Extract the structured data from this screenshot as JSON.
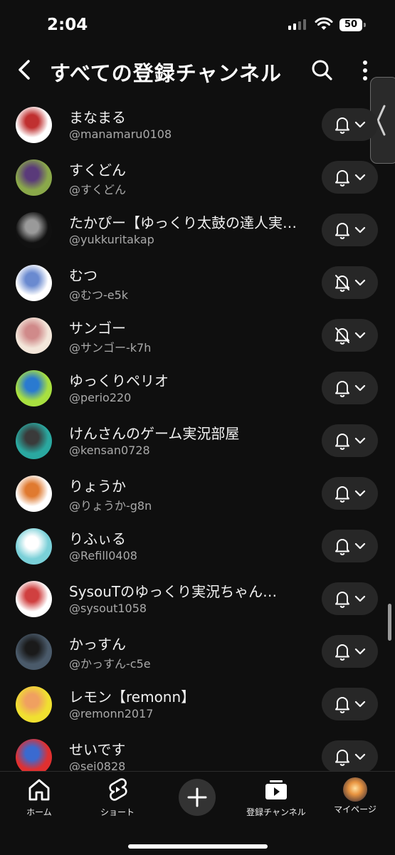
{
  "status_bar": {
    "time": "2:04",
    "battery": "50"
  },
  "header": {
    "title": "すべての登録チャンネル"
  },
  "channels": [
    {
      "name": "まなまる",
      "handle": "@manamaru0108",
      "notifications": "on",
      "avatar_colors": [
        "#ffffff",
        "#c03030"
      ]
    },
    {
      "name": "すくどん",
      "handle": "@すくどん",
      "notifications": "on",
      "avatar_colors": [
        "#8aa84a",
        "#5a3a7a"
      ]
    },
    {
      "name": "たかぴー【ゆっくり太鼓の達人実…",
      "handle": "@yukkuritakap",
      "notifications": "on",
      "avatar_colors": [
        "#111111",
        "#9a9a9a"
      ]
    },
    {
      "name": "むつ",
      "handle": "@むつ-e5k",
      "notifications": "off",
      "avatar_colors": [
        "#ffffff",
        "#6a8ad0"
      ]
    },
    {
      "name": "サンゴー",
      "handle": "@サンゴー-k7h",
      "notifications": "off",
      "avatar_colors": [
        "#f3e6da",
        "#d08a8a"
      ]
    },
    {
      "name": "ゆっくりペリオ",
      "handle": "@perio220",
      "notifications": "on",
      "avatar_colors": [
        "#a8e040",
        "#2a7ad0"
      ]
    },
    {
      "name": "けんさんのゲーム実況部屋",
      "handle": "@kensan0728",
      "notifications": "on",
      "avatar_colors": [
        "#2aa8a0",
        "#3a3a3a"
      ]
    },
    {
      "name": "りょうか",
      "handle": "@りょうか-g8n",
      "notifications": "on",
      "avatar_colors": [
        "#ffffff",
        "#e07a30"
      ]
    },
    {
      "name": "りふぃる",
      "handle": "@Refill0408",
      "notifications": "on",
      "avatar_colors": [
        "#7ad0d8",
        "#ffffff"
      ]
    },
    {
      "name": "SysouTのゆっくり実況ちゃん…",
      "handle": "@sysout1058",
      "notifications": "on",
      "avatar_colors": [
        "#ffffff",
        "#d04040"
      ]
    },
    {
      "name": "かっすん",
      "handle": "@かっすん-c5e",
      "notifications": "on",
      "avatar_colors": [
        "#4a5a6a",
        "#1a1a1a"
      ]
    },
    {
      "name": "レモン【remonn】",
      "handle": "@remonn2017",
      "notifications": "on",
      "avatar_colors": [
        "#f0e030",
        "#f0a060"
      ]
    },
    {
      "name": "せいです",
      "handle": "@sei0828",
      "notifications": "on",
      "avatar_colors": [
        "#e03030",
        "#3a6ad0"
      ]
    }
  ],
  "bottom_nav": {
    "home": "ホーム",
    "shorts": "ショート",
    "subscriptions": "登録チャンネル",
    "mypage": "マイページ"
  },
  "colors": {
    "background": "#0f0f0f",
    "pill": "#272727",
    "secondary_text": "#aaaaaa"
  }
}
